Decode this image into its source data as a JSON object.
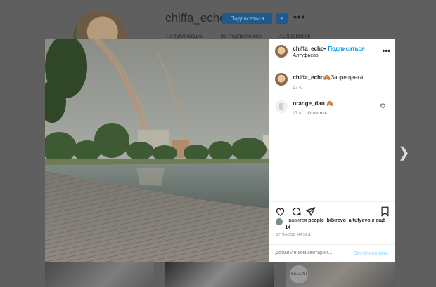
{
  "profile": {
    "username": "chiffa_echo",
    "follow_label": "Подписаться",
    "dropdown_label": "▾",
    "more_label": "•••",
    "stats": {
      "posts": "79 публикаций",
      "followers": "60 подписчиков",
      "following": "71 подписок"
    }
  },
  "thumbnail_text": "BELLINI",
  "post": {
    "header": {
      "username": "chiffa_echo",
      "separator": "•",
      "follow_label": "Подписаться",
      "location": "Алтуфьево",
      "more_label": "•••"
    },
    "caption": {
      "username": "chiffa_echo",
      "text": "🙈Запрещенка!",
      "time": "17 ч."
    },
    "comments": [
      {
        "username": "orange_dao",
        "text": "🙈",
        "time": "17 ч.",
        "reply_label": "Ответить"
      }
    ],
    "likes": {
      "prefix": "Нравится ",
      "user": "people_bibirevo_altufyevo",
      "middle": " и ",
      "others": "ещё 14"
    },
    "posted_time": "17 ЧАСОВ НАЗАД",
    "add_comment_placeholder": "Добавьте комментарий...",
    "publish_label": "Опубликовать"
  },
  "colors": {
    "accent": "#0095f6",
    "publish_disabled": "#b2dffc",
    "overlay": "#5f5f5f"
  },
  "icons": [
    "heart-icon",
    "comment-icon",
    "share-icon",
    "bookmark-icon",
    "more-icon",
    "chevron-right-icon"
  ]
}
